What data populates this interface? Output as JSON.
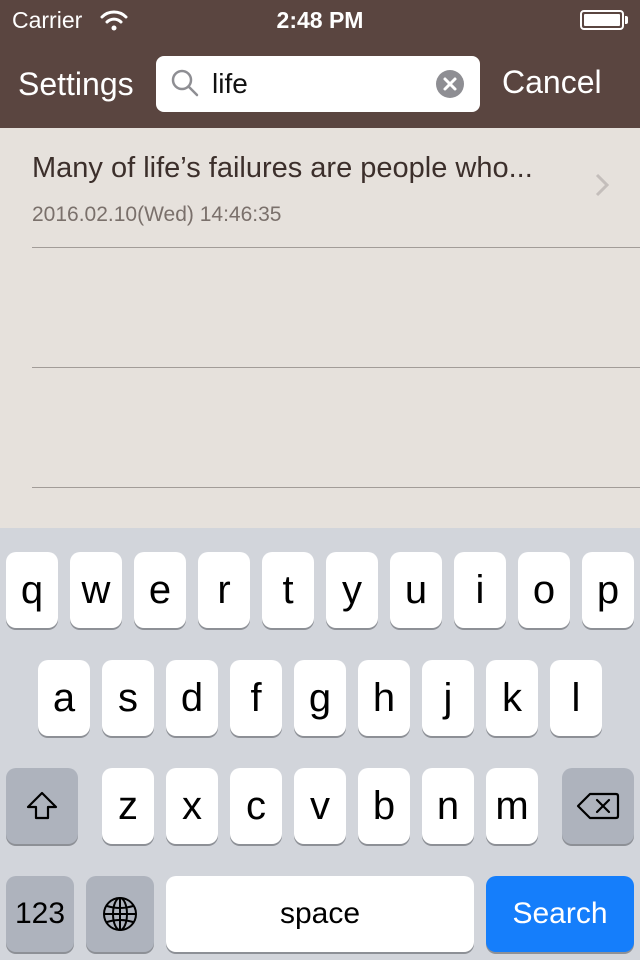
{
  "status_bar": {
    "carrier": "Carrier",
    "time": "2:48 PM"
  },
  "nav": {
    "settings_label": "Settings",
    "search_value": "life",
    "cancel_label": "Cancel"
  },
  "results": [
    {
      "title": "Many of life’s failures are people who...",
      "date": "2016.02.10(Wed) 14:46:35"
    }
  ],
  "keyboard": {
    "row1": [
      "q",
      "w",
      "e",
      "r",
      "t",
      "y",
      "u",
      "i",
      "o",
      "p"
    ],
    "row2": [
      "a",
      "s",
      "d",
      "f",
      "g",
      "h",
      "j",
      "k",
      "l"
    ],
    "row3": [
      "z",
      "x",
      "c",
      "v",
      "b",
      "n",
      "m"
    ],
    "numbers_label": "123",
    "space_label": "space",
    "search_label": "Search"
  },
  "colors": {
    "nav_background": "#5a4540",
    "list_background": "#e6e1dc",
    "search_key": "#157efb"
  }
}
